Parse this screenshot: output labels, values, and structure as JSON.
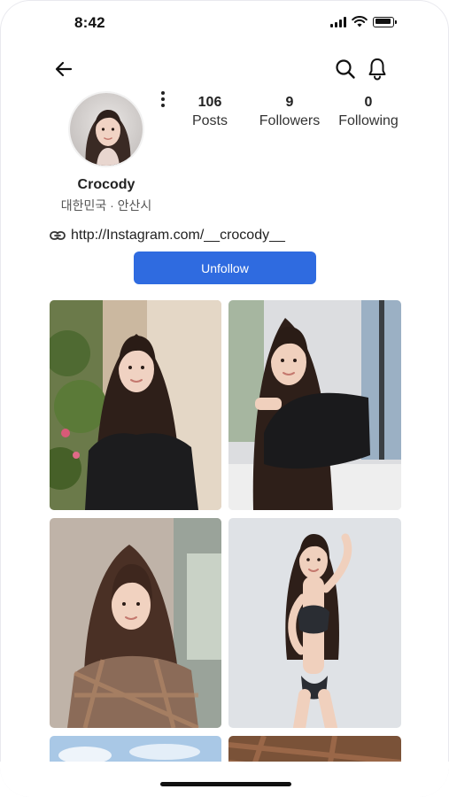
{
  "status_bar": {
    "time": "8:42",
    "icons": [
      "cellular-signal-icon",
      "wifi-icon",
      "battery-icon"
    ]
  },
  "nav": {
    "icons": [
      "back-arrow-icon",
      "search-icon",
      "bell-icon",
      "more-vertical-icon"
    ]
  },
  "profile": {
    "name": "Crocody",
    "location": "대한민국 · 안산시",
    "link": "http://Instagram.com/__crocody__",
    "stats": [
      {
        "count": "106",
        "label": "Posts"
      },
      {
        "count": "9",
        "label": "Followers"
      },
      {
        "count": "0",
        "label": "Following"
      }
    ]
  },
  "actions": {
    "unfollow_label": "Unfollow"
  },
  "colors": {
    "accent": "#2f6be0",
    "text": "#222222",
    "muted": "#555555",
    "background": "#ffffff"
  },
  "posts": [
    {
      "name": "post-1",
      "kind": "photo"
    },
    {
      "name": "post-2",
      "kind": "photo"
    },
    {
      "name": "post-3",
      "kind": "photo"
    },
    {
      "name": "post-4",
      "kind": "photo"
    },
    {
      "name": "post-5",
      "kind": "photo"
    },
    {
      "name": "post-6",
      "kind": "photo"
    }
  ]
}
